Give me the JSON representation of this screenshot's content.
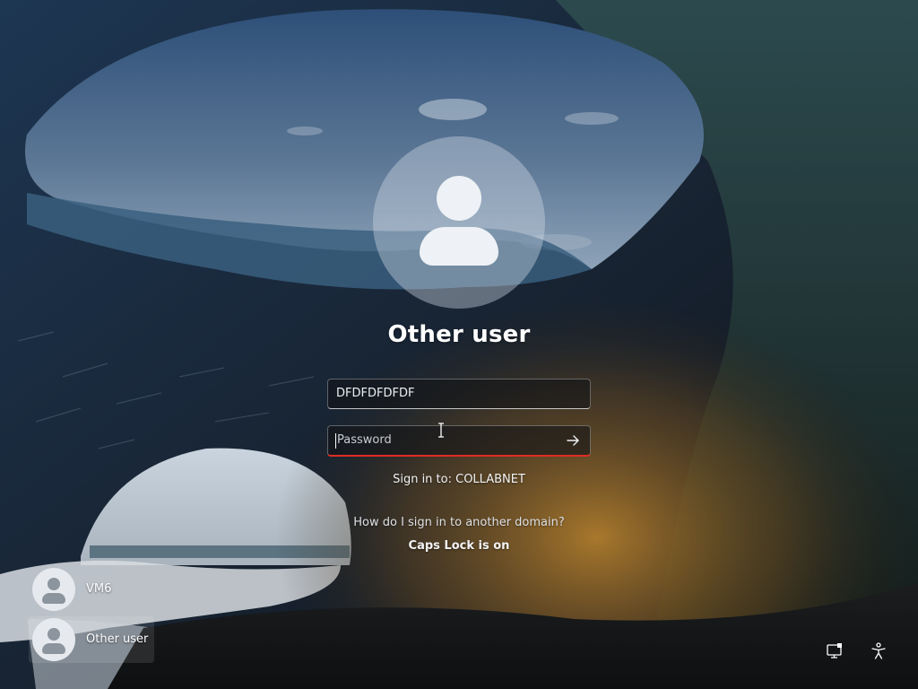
{
  "wallpaper": {
    "description_icon": "ice-cave-background"
  },
  "user": {
    "display_name": "Other user"
  },
  "username_field": {
    "value": "DFDFDFDFDF"
  },
  "password_field": {
    "placeholder": "Password",
    "submit_icon": "arrow-right-icon"
  },
  "sign_in_to": "Sign in to: COLLABNET",
  "other_domain_link": "How do I sign in to another domain?",
  "caps_lock_warning": "Caps Lock is on",
  "user_list": [
    {
      "name": "VM6",
      "icon": "user-avatar-icon",
      "selected": false
    },
    {
      "name": "Other user",
      "icon": "user-avatar-icon",
      "selected": true
    }
  ],
  "corner_buttons": [
    {
      "icon": "network-icon"
    },
    {
      "icon": "accessibility-icon"
    }
  ],
  "colors": {
    "error_underline": "#e02c25",
    "avatar_fill": "#eef1f5"
  }
}
